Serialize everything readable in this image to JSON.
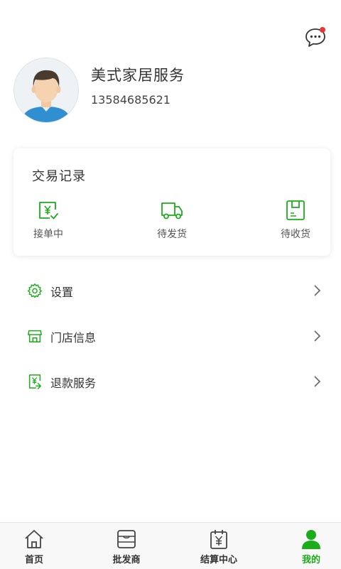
{
  "header": {
    "message_icon": "chat-bubble-icon",
    "has_unread": true
  },
  "profile": {
    "name": "美式家居服务",
    "phone": "13584685621",
    "avatar_icon": "user-avatar-icon"
  },
  "orders": {
    "title": "交易记录",
    "items": [
      {
        "label": "接单中",
        "icon": "receipt-yen-icon"
      },
      {
        "label": "待发货",
        "icon": "truck-icon"
      },
      {
        "label": "待收货",
        "icon": "package-icon"
      }
    ]
  },
  "menu": [
    {
      "label": "设置",
      "icon": "gear-icon"
    },
    {
      "label": "门店信息",
      "icon": "store-icon"
    },
    {
      "label": "退款服务",
      "icon": "refund-icon"
    }
  ],
  "tabbar": [
    {
      "label": "首页",
      "icon": "home-icon",
      "active": false
    },
    {
      "label": "批发商",
      "icon": "wholesaler-icon",
      "active": false
    },
    {
      "label": "结算中心",
      "icon": "calendar-yen-icon",
      "active": false
    },
    {
      "label": "我的",
      "icon": "person-icon",
      "active": true
    }
  ],
  "colors": {
    "accent": "#1aad19",
    "badge": "#e53935",
    "text": "#333333"
  }
}
